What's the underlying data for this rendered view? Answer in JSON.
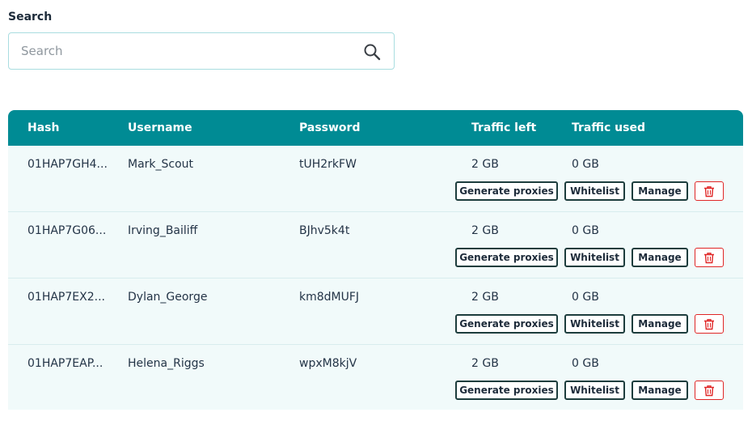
{
  "search": {
    "label": "Search",
    "placeholder": "Search",
    "value": ""
  },
  "table": {
    "columns": {
      "hash": "Hash",
      "username": "Username",
      "password": "Password",
      "traffic_left": "Traffic left",
      "traffic_used": "Traffic used"
    },
    "actions": {
      "generate": "Generate proxies",
      "whitelist": "Whitelist",
      "manage": "Manage"
    },
    "rows": [
      {
        "hash": "01HAP7GH4...",
        "username": "Mark_Scout",
        "password": "tUH2rkFW",
        "traffic_left": "2 GB",
        "traffic_used": "0 GB"
      },
      {
        "hash": "01HAP7G06...",
        "username": "Irving_Bailiff",
        "password": "BJhv5k4t",
        "traffic_left": "2 GB",
        "traffic_used": "0 GB"
      },
      {
        "hash": "01HAP7EX2...",
        "username": "Dylan_George",
        "password": "km8dMUFJ",
        "traffic_left": "2 GB",
        "traffic_used": "0 GB"
      },
      {
        "hash": "01HAP7EAP...",
        "username": "Helena_Riggs",
        "password": "wpxM8kjV",
        "traffic_left": "2 GB",
        "traffic_used": "0 GB"
      }
    ]
  },
  "icons": {
    "search": "search-icon",
    "delete": "trash-icon"
  },
  "colors": {
    "header_bg": "#008b94",
    "row_bg": "#f1fafa",
    "delete": "#e02626"
  }
}
